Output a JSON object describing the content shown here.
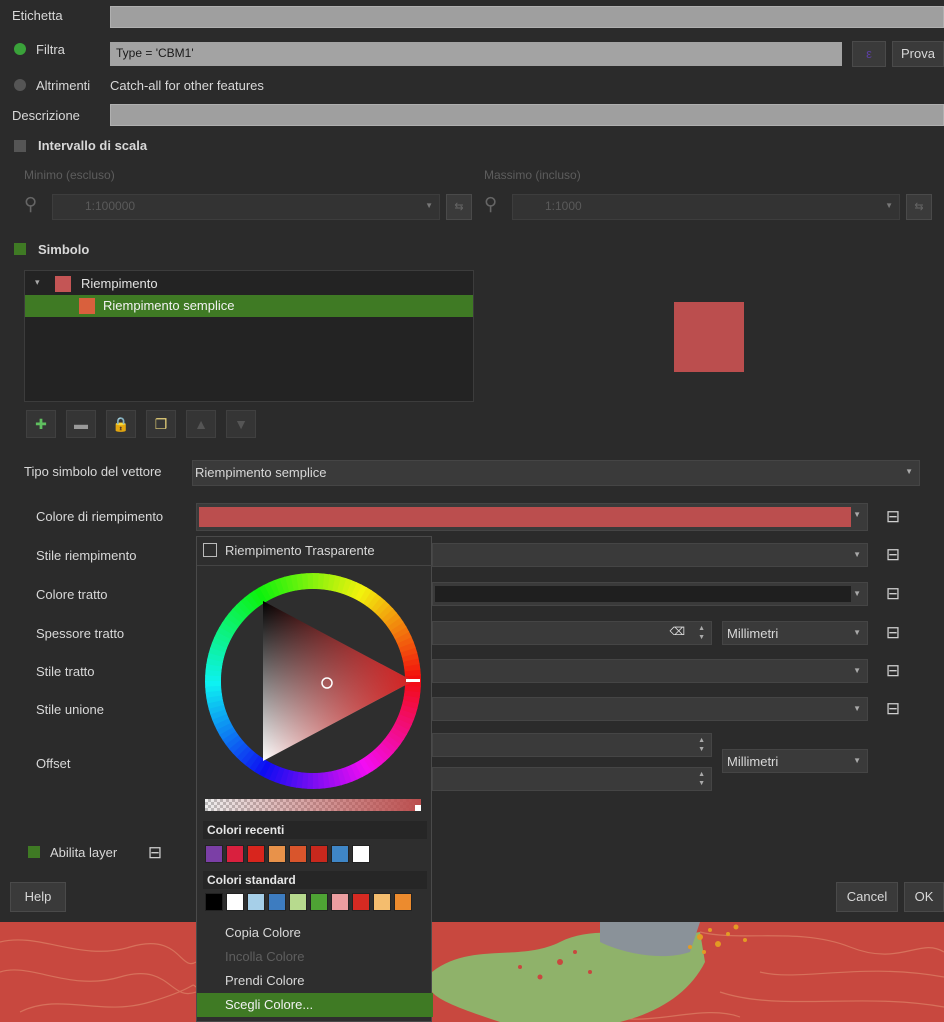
{
  "labels": {
    "etichetta": "Etichetta",
    "filtra": "Filtra",
    "altrimenti": "Altrimenti",
    "altrimenti_desc": "Catch-all for other features",
    "descrizione": "Descrizione",
    "intervallo": "Intervallo di scala",
    "minimo": "Minimo (escluso)",
    "massimo": "Massimo (incluso)",
    "simbolo": "Simbolo",
    "tipo_simbolo": "Tipo simbolo del vettore",
    "abilita_layer": "Abilita layer"
  },
  "filter": {
    "expression": "Type = 'CBM1'",
    "test_button": "Prova",
    "expr_button": "ε"
  },
  "scale": {
    "min_value": "1:100000",
    "max_value": "1:1000"
  },
  "tree": {
    "parent": "Riempimento",
    "child": "Riempimento semplice",
    "expander": "▾"
  },
  "symbol_type": "Riempimento semplice",
  "properties": {
    "fill_color": "Colore di riempimento",
    "fill_style": "Stile riempimento",
    "stroke_color": "Colore tratto",
    "stroke_width": "Spessore tratto",
    "stroke_style": "Stile tratto",
    "join_style": "Stile unione",
    "offset": "Offset"
  },
  "units": {
    "stroke_width_unit": "Millimetri",
    "offset_unit": "Millimetri"
  },
  "buttons": {
    "help": "Help",
    "cancel": "Cancel",
    "ok": "OK"
  },
  "popup": {
    "transparent_label": "Riempimento Trasparente",
    "recent_header": "Colori recenti",
    "standard_header": "Colori standard",
    "recent_colors": [
      "#7b3fa6",
      "#d9203e",
      "#d8251d",
      "#e8924a",
      "#d9552c",
      "#c8281d",
      "#3f86c6",
      "#ffffff"
    ],
    "standard_colors": [
      "#000000",
      "#ffffff",
      "#a6cfe8",
      "#3d7cc0",
      "#b7da8e",
      "#4ea334",
      "#ec9ea0",
      "#d62a22",
      "#f4bd6e",
      "#ec8b2e"
    ],
    "menu": {
      "copy": "Copia Colore",
      "paste": "Incolla Colore",
      "pick": "Prendi Colore",
      "choose": "Scegli Colore..."
    }
  },
  "colors": {
    "accent_green": "#3f7a24",
    "fill_color": "#bb4e4e",
    "tree_swatch_parent": "#c45555",
    "tree_swatch_child": "#d9603d"
  }
}
